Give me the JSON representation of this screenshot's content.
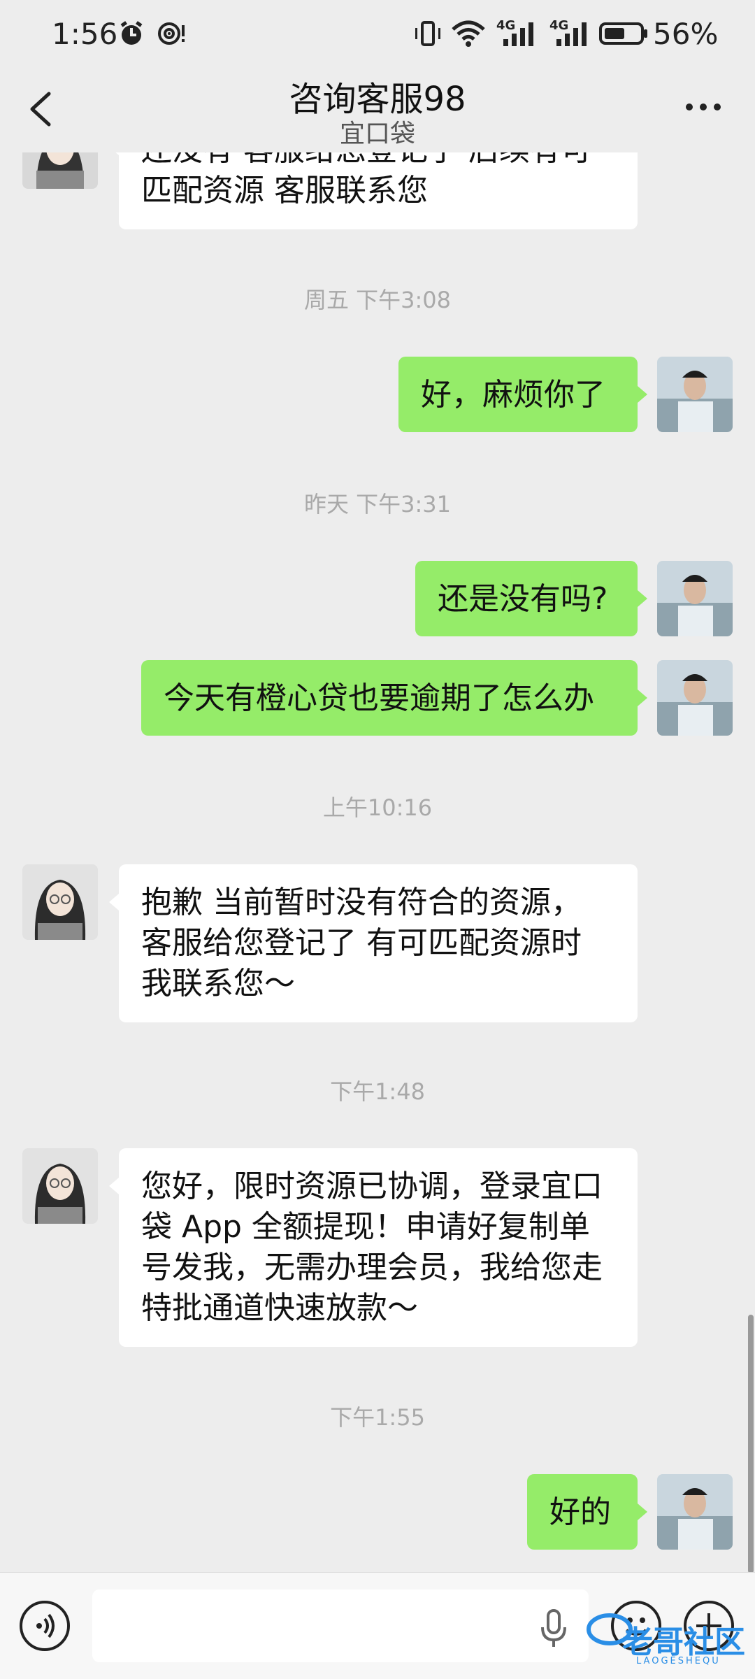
{
  "status_bar": {
    "time": "1:56",
    "battery": "56%",
    "network1": "4G",
    "network2": "4G"
  },
  "header": {
    "title": "咨询客服98",
    "subtitle": "宜口袋"
  },
  "messages": [
    {
      "side": "in",
      "lines": [
        "还没有 客服给您登记了 后续有可",
        "匹配资源 客服联系您"
      ]
    },
    {
      "timestamp": "周五 下午3:08"
    },
    {
      "side": "out",
      "text": "好，麻烦你了"
    },
    {
      "timestamp": "昨天 下午3:31"
    },
    {
      "side": "out",
      "text": "还是没有吗?"
    },
    {
      "side": "out",
      "text": "今天有橙心贷也要逾期了怎么办"
    },
    {
      "timestamp": "上午10:16"
    },
    {
      "side": "in",
      "lines": [
        "抱歉  当前暂时没有符合的资源，",
        "客服给您登记了 有可匹配资源时",
        "我联系您～"
      ]
    },
    {
      "timestamp": "下午1:48"
    },
    {
      "side": "in",
      "lines": [
        "您好，限时资源已协调，登录宜口",
        "袋 App 全额提现！申请好复制单",
        "号发我，无需办理会员，我给您走",
        "特批通道快速放款～"
      ]
    },
    {
      "timestamp": "下午1:55"
    },
    {
      "side": "out",
      "text": "好的"
    }
  ],
  "input_bar": {
    "placeholder": ""
  },
  "watermark": {
    "text": "老哥社区",
    "sub": "LAOGESHEQU"
  },
  "colors": {
    "outgoing_bubble": "#95ec69",
    "incoming_bubble": "#ffffff",
    "background": "#ededed"
  }
}
